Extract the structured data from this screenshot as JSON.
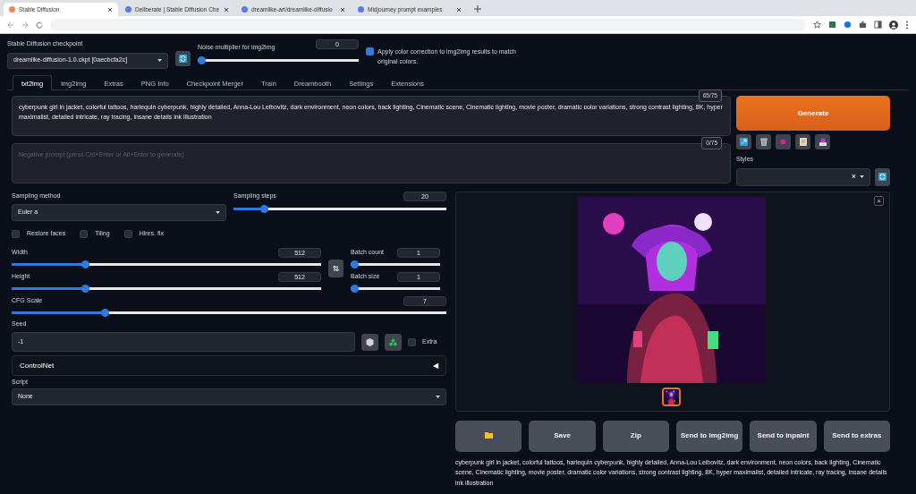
{
  "browser": {
    "tabs": [
      {
        "title": "Stable Diffusion",
        "selected": true
      },
      {
        "title": "Deliberate | Stable Diffusion Che",
        "selected": false
      },
      {
        "title": "dreamlike-art/dreamlike-diffusio",
        "selected": false
      },
      {
        "title": "Midjourney prompt examples",
        "selected": false
      }
    ]
  },
  "checkpoint": {
    "label": "Stable Diffusion checkpoint",
    "value": "dreamlike-diffusion-1.0.ckpt [0aecbcfa2c]"
  },
  "noise": {
    "label": "Noise multiplier for img2img",
    "value": "0",
    "level": 0
  },
  "color_correction": {
    "label": "Apply color correction to img2img results to match original colors.",
    "checked": true
  },
  "tabs": [
    {
      "label": "txt2img",
      "selected": true
    },
    {
      "label": "img2img",
      "selected": false
    },
    {
      "label": "Extras",
      "selected": false
    },
    {
      "label": "PNG Info",
      "selected": false
    },
    {
      "label": "Checkpoint Merger",
      "selected": false
    },
    {
      "label": "Train",
      "selected": false
    },
    {
      "label": "Dreambooth",
      "selected": false
    },
    {
      "label": "Settings",
      "selected": false
    },
    {
      "label": "Extensions",
      "selected": false
    }
  ],
  "prompt": {
    "value": "cyberpunk girl in jacket, colorful tattoos, harlequin cyberpunk, highly detailed, Anna-Lou Leibovitz, dark environment, neon colors, back lighting, Cinematic scene, Cinematic lighting, movie poster, dramatic color variations, strong contrast lighting, 8K, hyper maximalist, detailed intricate, ray tracing, insane details ink illustration",
    "count": "65/75"
  },
  "negative_prompt": {
    "placeholder": "Negative prompt (press Ctrl+Enter or Alt+Enter to generate)",
    "count": "0/75"
  },
  "generate": "Generate",
  "styles": {
    "label": "Styles",
    "clear": "×"
  },
  "sampling_method": {
    "label": "Sampling method",
    "value": "Euler a"
  },
  "sampling_steps": {
    "label": "Sampling steps",
    "value": "20",
    "level": 0.13
  },
  "checkboxes": [
    {
      "label": "Restore faces",
      "checked": false
    },
    {
      "label": "Tiling",
      "checked": false
    },
    {
      "label": "Hires. fix",
      "checked": false
    }
  ],
  "size_sliders": [
    {
      "label": "Width",
      "value": "512",
      "level": 0.23
    },
    {
      "label": "Height",
      "value": "512",
      "level": 0.23
    }
  ],
  "batch_sliders": [
    {
      "label": "Batch count",
      "value": "1",
      "level": 0
    },
    {
      "label": "Batch size",
      "value": "1",
      "level": 0
    }
  ],
  "cfg_scale": {
    "label": "CFG Scale",
    "value": "7",
    "level": 0.21
  },
  "seed": {
    "label": "Seed",
    "value": "-1"
  },
  "extra": {
    "label": "Extra",
    "checked": false
  },
  "controlnet": {
    "title": "ControlNet",
    "toggle": "◀",
    "expanded": false
  },
  "script": {
    "label": "Script",
    "value": "None"
  },
  "gallery": {
    "close": "×"
  },
  "output_buttons": [
    {
      "kind": "folder"
    },
    {
      "kind": "text",
      "label": "Save"
    },
    {
      "kind": "text",
      "label": "Zip"
    },
    {
      "kind": "text",
      "label": "Send to img2img"
    },
    {
      "kind": "text",
      "label": "Send to inpaint"
    },
    {
      "kind": "text",
      "label": "Send to extras"
    }
  ],
  "info": "cyberpunk girl in jacket, colorful tattoos, harlequin cyberpunk, highly detailed, Anna-Lou Leibovitz, dark environment, neon colors, back lighting, Cinematic scene, Cinematic lighting, movie poster, dramatic color variations, strong contrast lighting, 8K, hyper maximalist, detailed intricate, ray tracing, insane details ink illustration"
}
